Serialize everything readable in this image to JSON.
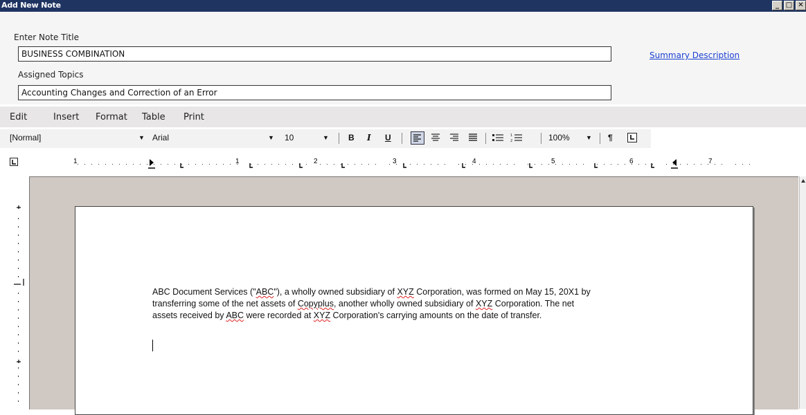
{
  "window": {
    "title": "Add New Note",
    "buttons": [
      "_",
      "□",
      "✕"
    ]
  },
  "form": {
    "title_label": "Enter Note Title",
    "title_value": "BUSINESS COMBINATION",
    "summary_link": "Summary Description",
    "topics_label": "Assigned Topics",
    "topics_value": "Accounting Changes and Correction of an Error"
  },
  "menu": {
    "items": [
      "Edit",
      "Insert",
      "Format",
      "Table",
      "Print"
    ]
  },
  "toolbar": {
    "style": "[Normal]",
    "font": "Arial",
    "size": "10",
    "bold": "B",
    "italic": "I",
    "underline": "U",
    "zoom": "100%",
    "pilcrow": "¶"
  },
  "ruler": {
    "numbers": [
      "1",
      "1",
      "2",
      "3",
      "4",
      "5",
      "6",
      "7"
    ]
  },
  "document": {
    "line1_a": "ABC Document Services (\"",
    "abc1": "ABC",
    "line1_b": "\"), a wholly owned subsidiary of ",
    "xyz1": "XYZ",
    "line1_c": " Corporation, was formed on May 15, 20X1 by",
    "line2_a": "transferring some of the net assets of ",
    "copyplus": "Copyplus",
    "line2_b": ", another wholly owned subsidiary of ",
    "xyz2": "XYZ",
    "line2_c": " Corporation.  The net",
    "line3_a": "assets received by ",
    "abc2": "ABC",
    "line3_b": " were recorded at ",
    "xyz3": "XYZ",
    "line3_c": " Corporation's carrying amounts on the date of transfer."
  }
}
